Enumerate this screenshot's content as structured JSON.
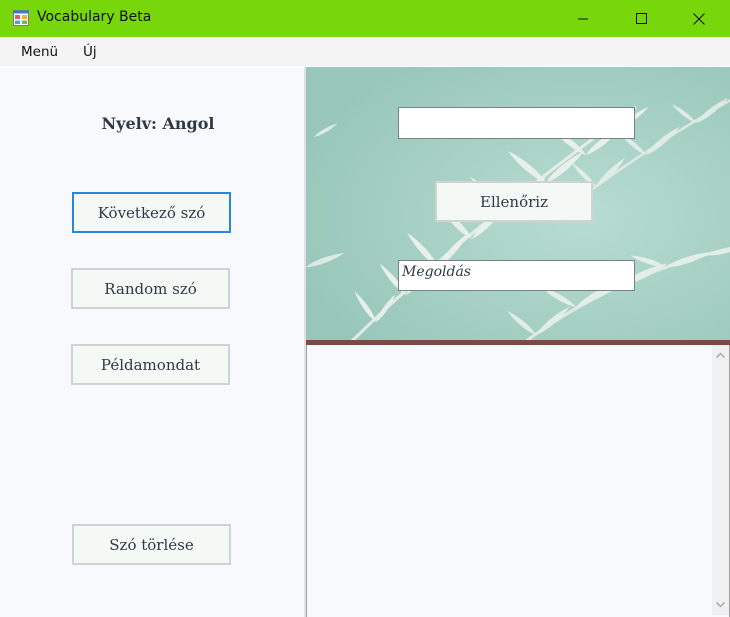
{
  "window": {
    "title": "Vocabulary Beta",
    "titlebar_color": "#78d70a"
  },
  "menu": {
    "items": [
      {
        "label": "Menü"
      },
      {
        "label": "Új"
      }
    ]
  },
  "left_panel": {
    "language_label": "Nyelv: Angol",
    "buttons": {
      "next_word": "Következő szó",
      "random_word": "Random szó",
      "example_sentence": "Példamondat",
      "delete_word": "Szó törlése"
    }
  },
  "quiz": {
    "answer_input": "",
    "check_button": "Ellenőriz",
    "solution_field": "Megoldás"
  },
  "output_text": ""
}
